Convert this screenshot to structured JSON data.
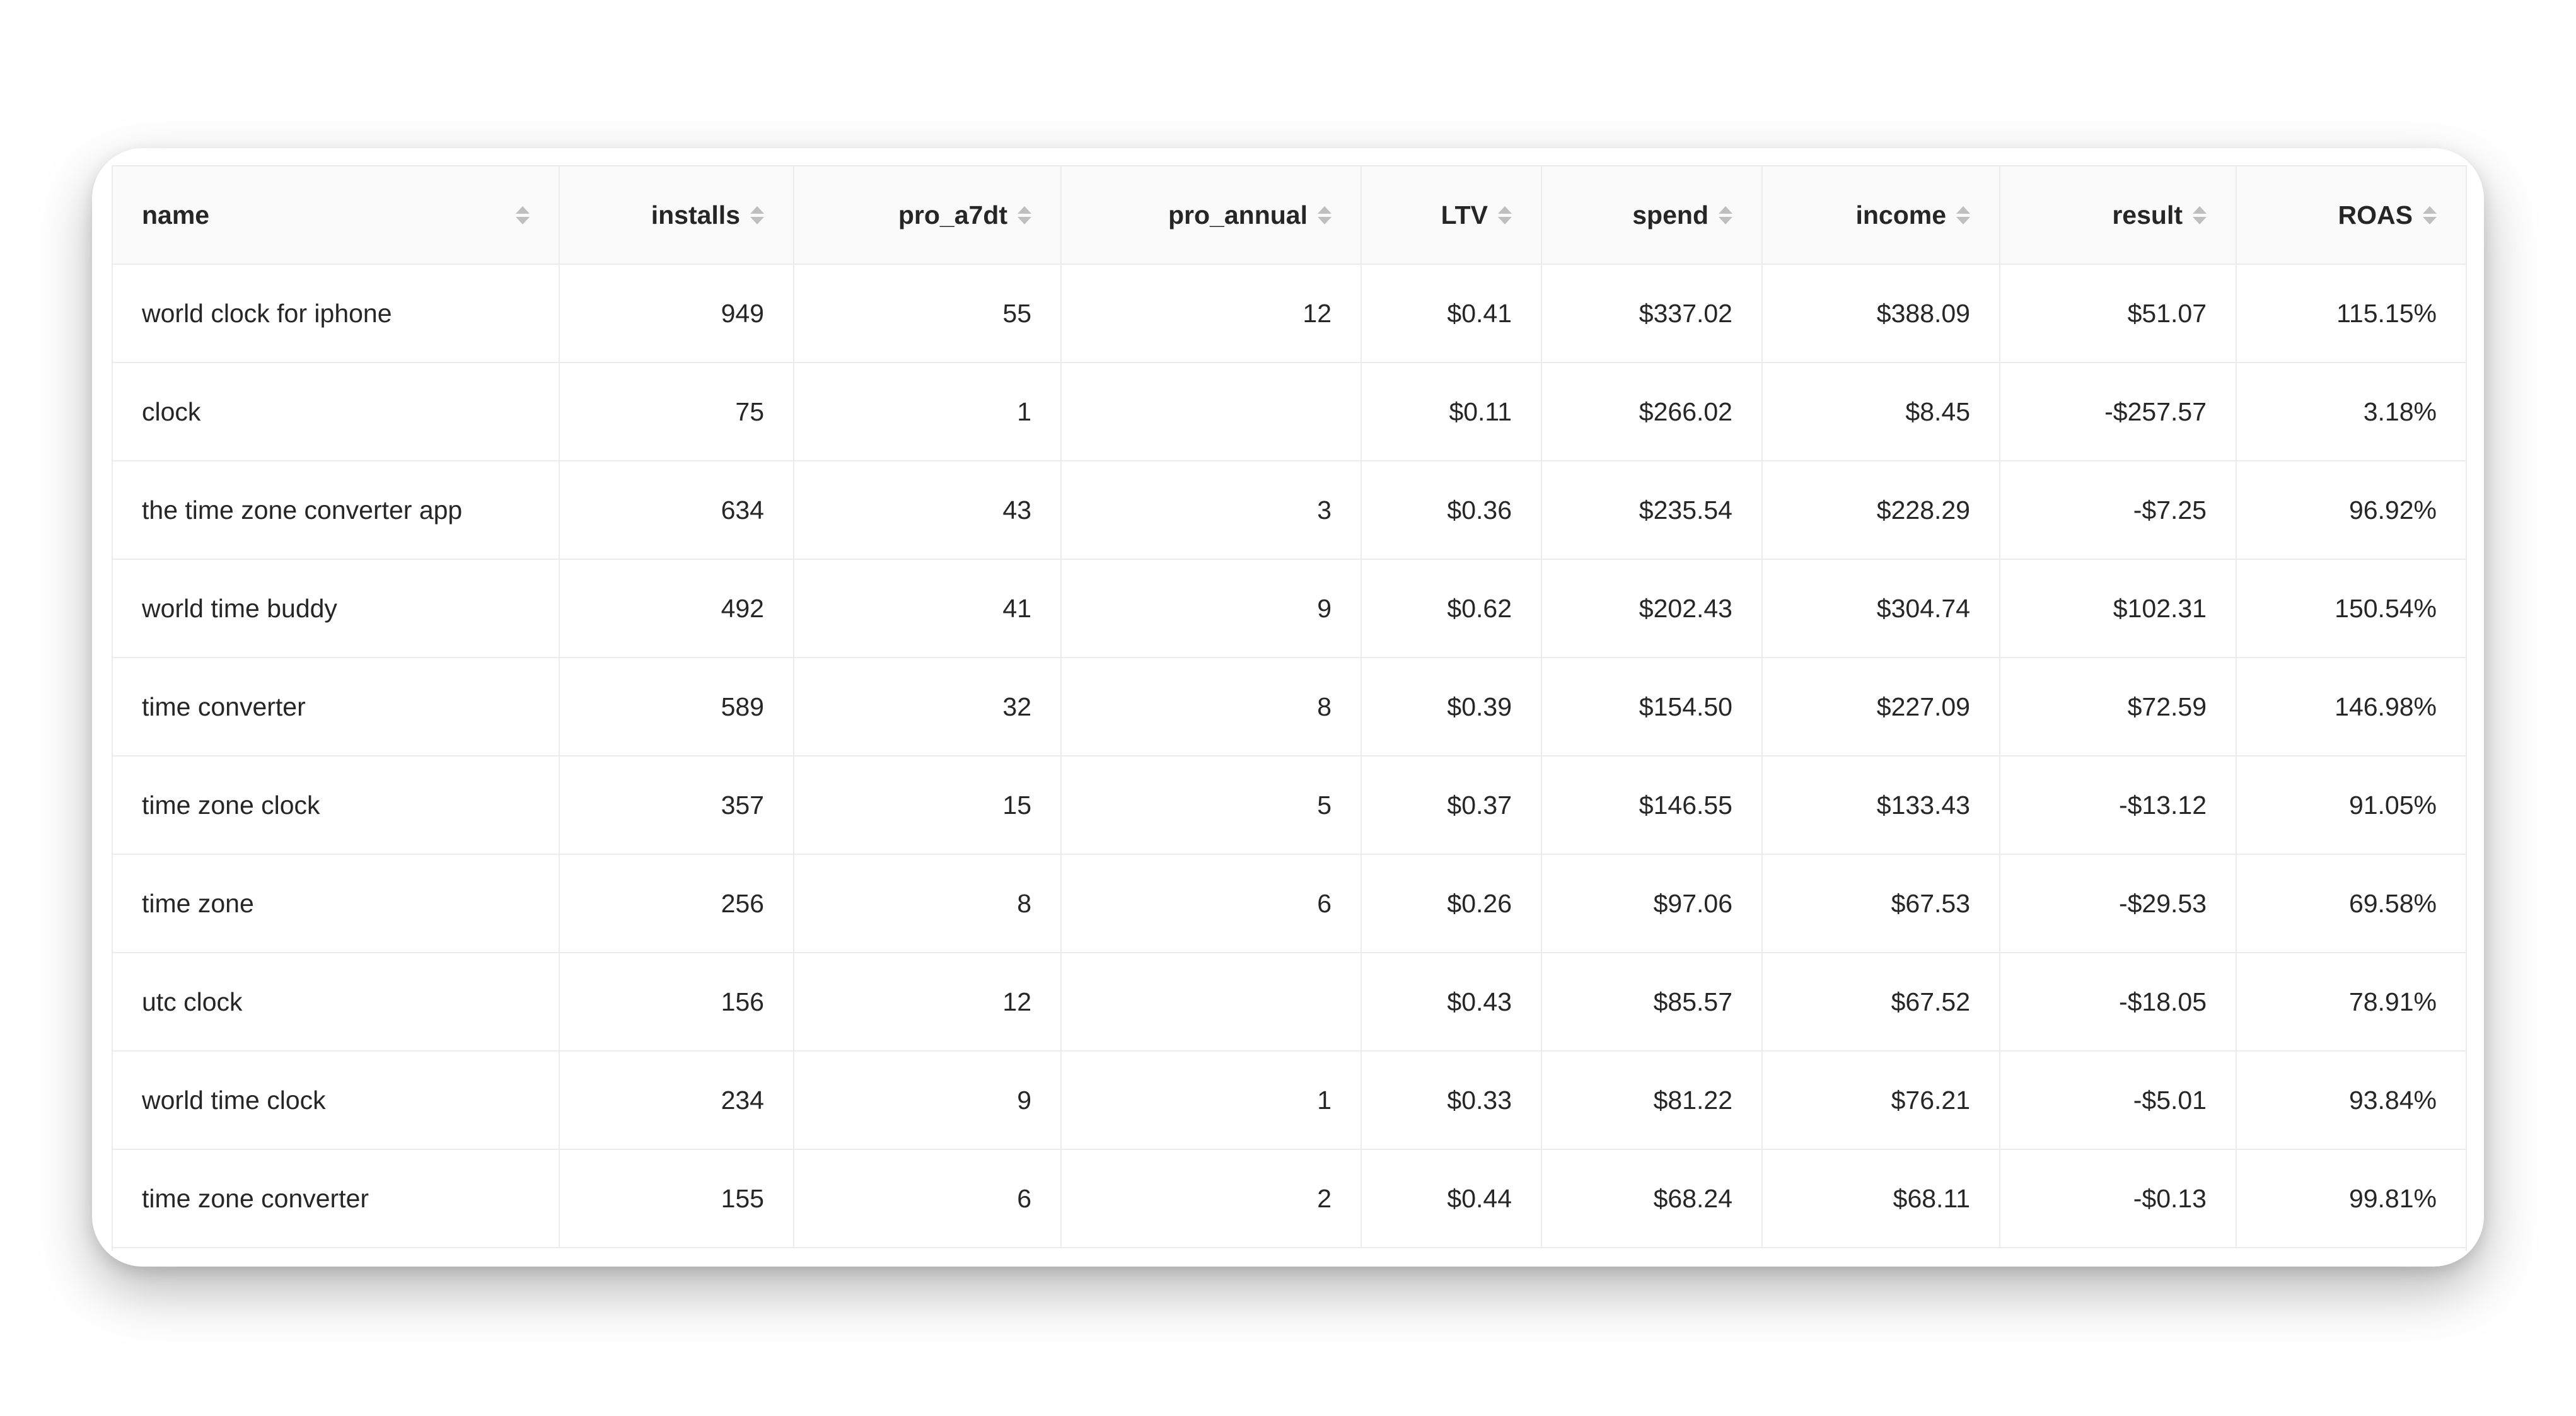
{
  "table": {
    "columns": [
      {
        "key": "name",
        "label": "name",
        "align": "left"
      },
      {
        "key": "installs",
        "label": "installs",
        "align": "right"
      },
      {
        "key": "pro_a7dt",
        "label": "pro_a7dt",
        "align": "right"
      },
      {
        "key": "pro_annual",
        "label": "pro_annual",
        "align": "right"
      },
      {
        "key": "ltv",
        "label": "LTV",
        "align": "right"
      },
      {
        "key": "spend",
        "label": "spend",
        "align": "right"
      },
      {
        "key": "income",
        "label": "income",
        "align": "right"
      },
      {
        "key": "result",
        "label": "result",
        "align": "right"
      },
      {
        "key": "roas",
        "label": "ROAS",
        "align": "right"
      }
    ],
    "rows": [
      [
        "world clock for iphone",
        "949",
        "55",
        "12",
        "$0.41",
        "$337.02",
        "$388.09",
        "$51.07",
        "115.15%"
      ],
      [
        "clock",
        "75",
        "1",
        "",
        "$0.11",
        "$266.02",
        "$8.45",
        "-$257.57",
        "3.18%"
      ],
      [
        "the time zone converter app",
        "634",
        "43",
        "3",
        "$0.36",
        "$235.54",
        "$228.29",
        "-$7.25",
        "96.92%"
      ],
      [
        "world time buddy",
        "492",
        "41",
        "9",
        "$0.62",
        "$202.43",
        "$304.74",
        "$102.31",
        "150.54%"
      ],
      [
        "time converter",
        "589",
        "32",
        "8",
        "$0.39",
        "$154.50",
        "$227.09",
        "$72.59",
        "146.98%"
      ],
      [
        "time zone clock",
        "357",
        "15",
        "5",
        "$0.37",
        "$146.55",
        "$133.43",
        "-$13.12",
        "91.05%"
      ],
      [
        "time zone",
        "256",
        "8",
        "6",
        "$0.26",
        "$97.06",
        "$67.53",
        "-$29.53",
        "69.58%"
      ],
      [
        "utc clock",
        "156",
        "12",
        "",
        "$0.43",
        "$85.57",
        "$67.52",
        "-$18.05",
        "78.91%"
      ],
      [
        "world time clock",
        "234",
        "9",
        "1",
        "$0.33",
        "$81.22",
        "$76.21",
        "-$5.01",
        "93.84%"
      ],
      [
        "time zone converter",
        "155",
        "6",
        "2",
        "$0.44",
        "$68.24",
        "$68.11",
        "-$0.13",
        "99.81%"
      ]
    ]
  }
}
